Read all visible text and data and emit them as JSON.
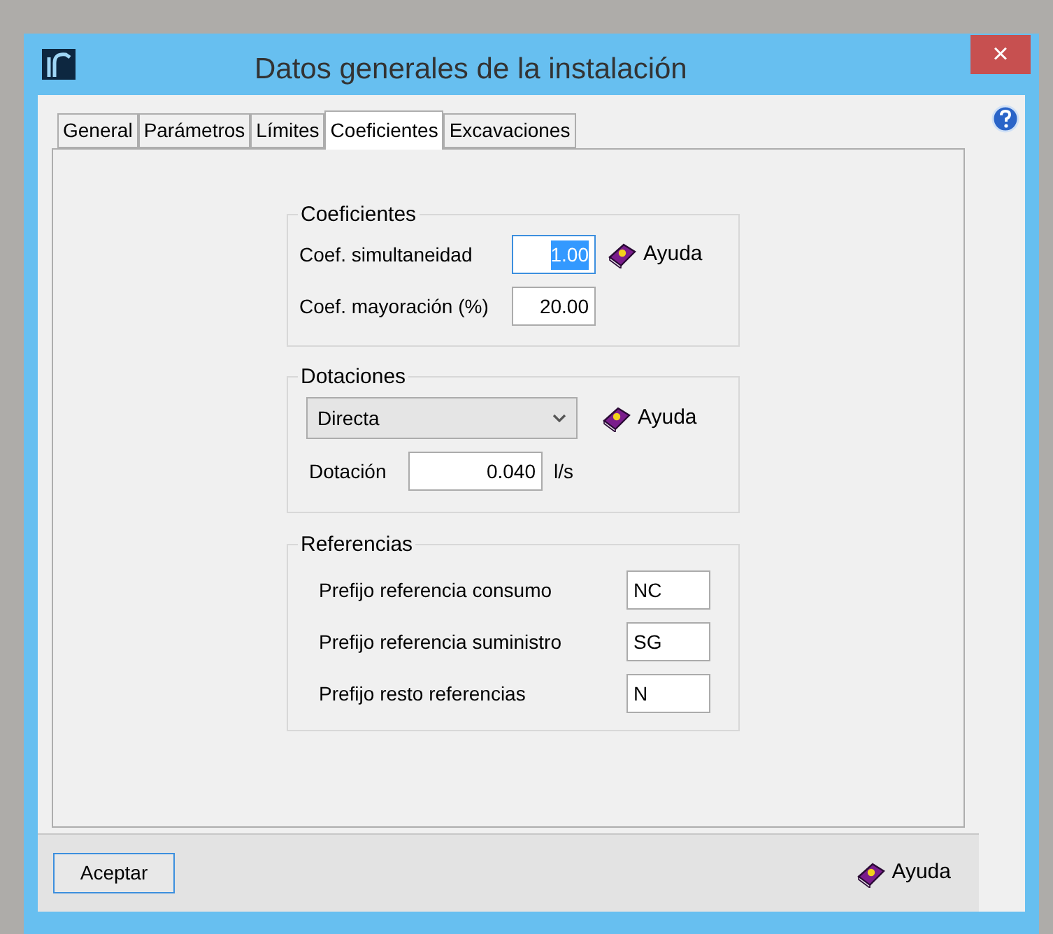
{
  "window": {
    "title": "Datos generales de la instalación",
    "close": "×"
  },
  "tabs": [
    {
      "label": "General",
      "selected": false
    },
    {
      "label": "Parámetros",
      "selected": false
    },
    {
      "label": "Límites",
      "selected": false
    },
    {
      "label": "Coeficientes",
      "selected": true
    },
    {
      "label": "Excavaciones",
      "selected": false
    }
  ],
  "coeficientes": {
    "title": "Coeficientes",
    "help": "Ayuda",
    "fields": [
      {
        "label": "Coef. simultaneidad",
        "value": "1.00",
        "focused": true
      },
      {
        "label": "Coef. mayoración (%)",
        "value": "20.00",
        "focused": false
      }
    ]
  },
  "dotaciones": {
    "title": "Dotaciones",
    "help": "Ayuda",
    "dropdown": "Directa",
    "field": {
      "label": "Dotación",
      "value": "0.040",
      "unit": "l/s"
    }
  },
  "referencias": {
    "title": "Referencias",
    "fields": [
      {
        "label": "Prefijo referencia consumo",
        "value": "NC"
      },
      {
        "label": "Prefijo referencia suministro",
        "value": "SG"
      },
      {
        "label": "Prefijo resto referencias",
        "value": "N"
      }
    ]
  },
  "footer": {
    "accept": "Aceptar",
    "help": "Ayuda"
  }
}
